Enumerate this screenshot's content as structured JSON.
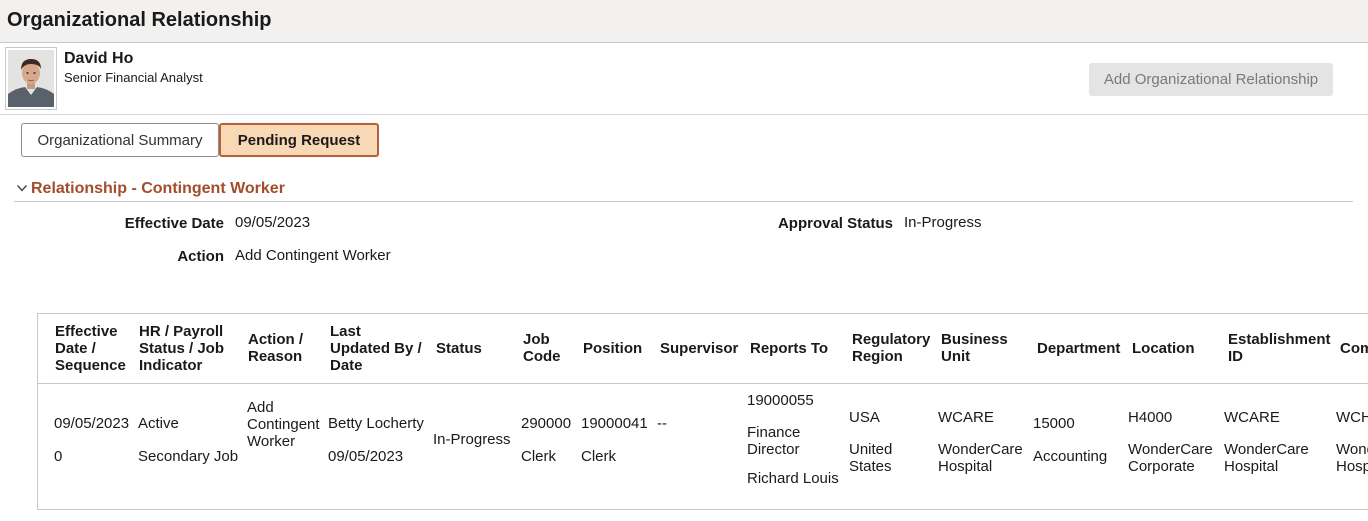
{
  "page": {
    "title": "Organizational Relationship"
  },
  "person": {
    "name": "David Ho",
    "job_title": "Senior Financial Analyst"
  },
  "actions": {
    "add_label": "Add Organizational Relationship"
  },
  "tabs": [
    {
      "label": "Organizational Summary",
      "selected": false
    },
    {
      "label": "Pending Request",
      "selected": true
    }
  ],
  "section": {
    "title": "Relationship - Contingent Worker",
    "expanded": true
  },
  "details": {
    "effective_date_label": "Effective Date",
    "effective_date": "09/05/2023",
    "approval_status_label": "Approval Status",
    "approval_status": "In-Progress",
    "action_label": "Action",
    "action": "Add Contingent Worker"
  },
  "grid": {
    "headers": [
      "Effective\nDate /\nSequence",
      "HR / Payroll\nStatus / Job\nIndicator",
      "Action /\nReason",
      "Last\nUpdated By /\nDate",
      "Status",
      "Job\nCode",
      "Position",
      "Supervisor",
      "Reports To",
      "Regulatory\nRegion",
      "Business\nUnit",
      "Department",
      "Location",
      "Establishment\nID",
      "Company"
    ],
    "row": {
      "effective_date": "09/05/2023",
      "sequence": "0",
      "hr_status": "Active",
      "job_indicator": "Secondary Job",
      "action_reason": "Add\nContingent\nWorker",
      "last_updated_by": "Betty Locherty",
      "last_updated_date": "09/05/2023",
      "status": "In-Progress",
      "job_code": "290000",
      "job_code_desc": "Clerk",
      "position": "19000041",
      "position_desc": "Clerk",
      "supervisor": "--",
      "reports_to": "19000055",
      "reports_to_desc": "Finance\nDirector",
      "reports_to_name": "Richard Louis",
      "regulatory_region": "USA",
      "regulatory_region_desc": "United\nStates",
      "business_unit": "WCARE",
      "business_unit_desc": "WonderCare\nHospital",
      "department": "15000",
      "department_desc": "Accounting",
      "location": "H4000",
      "location_desc": "WonderCare\nCorporate",
      "establishment_id": "WCARE",
      "establishment_desc": "WonderCare\nHospital",
      "company": "WCH",
      "company_desc": "WonderCare\nHospital"
    }
  }
}
